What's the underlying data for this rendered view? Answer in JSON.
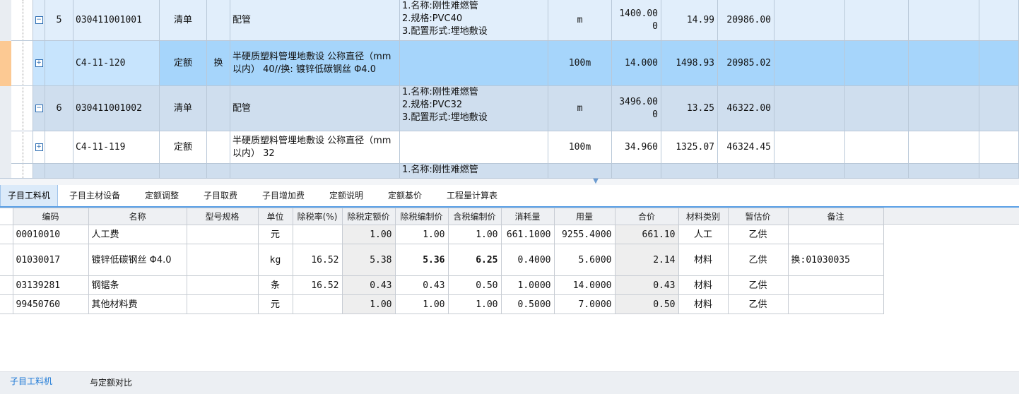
{
  "top_grid": {
    "rows": [
      {
        "toggle": "⊟",
        "seq": "5",
        "code": "030411001001",
        "type": "清单",
        "swap": "",
        "name": "配管",
        "feature": "1.名称:刚性难燃管\n2.规格:PVC40\n3.配置形式:埋地敷设",
        "unit": "m",
        "qty": "1400.00\n0",
        "price": "14.99",
        "total": "20986.00"
      },
      {
        "toggle": "⊞",
        "seq": "",
        "code": "C4-11-120",
        "type": "定额",
        "swap": "换",
        "name": "半硬质塑料管埋地敷设 公称直径（mm以内） 40//换: 镀锌低碳钢丝 Φ4.0",
        "feature": "",
        "unit": "100m",
        "qty": "14.000",
        "price": "1498.93",
        "total": "20985.02"
      },
      {
        "toggle": "⊟",
        "seq": "6",
        "code": "030411001002",
        "type": "清单",
        "swap": "",
        "name": "配管",
        "feature": "1.名称:刚性难燃管\n2.规格:PVC32\n3.配置形式:埋地敷设",
        "unit": "m",
        "qty": "3496.00\n0",
        "price": "13.25",
        "total": "46322.00"
      },
      {
        "toggle": "⊞",
        "seq": "",
        "code": "C4-11-119",
        "type": "定额",
        "swap": "",
        "name": "半硬质塑料管埋地敷设 公称直径（mm以内） 32",
        "feature": "",
        "unit": "100m",
        "qty": "34.960",
        "price": "1325.07",
        "total": "46324.45"
      },
      {
        "toggle": "",
        "seq": "",
        "code": "",
        "type": "",
        "swap": "",
        "name": "",
        "feature": "1.名称:刚性难燃管",
        "unit": "",
        "qty": "",
        "price": "",
        "total": ""
      }
    ]
  },
  "tabs": [
    "子目工料机",
    "子目主材设备",
    "定额调整",
    "子目取费",
    "子目增加费",
    "定额说明",
    "定额基价",
    "工程量计算表"
  ],
  "table": {
    "headers": [
      "编码",
      "名称",
      "型号规格",
      "单位",
      "除税率(%)",
      "除税定额价",
      "除税编制价",
      "含税编制价",
      "消耗量",
      "用量",
      "合价",
      "材料类别",
      "暂估价",
      "备注"
    ],
    "rows": [
      [
        "00010010",
        "人工费",
        "",
        "元",
        "",
        "1.00",
        "1.00",
        "1.00",
        "661.1000",
        "9255.4000",
        "661.10",
        "人工",
        "乙供",
        ""
      ],
      [
        "01030017",
        "镀锌低碳钢丝 Φ4.0",
        "",
        "kg",
        "16.52",
        "5.38",
        "5.36",
        "6.25",
        "0.4000",
        "5.6000",
        "2.14",
        "材料",
        "乙供",
        "换:01030035"
      ],
      [
        "03139281",
        "钢锯条",
        "",
        "条",
        "16.52",
        "0.43",
        "0.43",
        "0.50",
        "1.0000",
        "14.0000",
        "0.43",
        "材料",
        "乙供",
        ""
      ],
      [
        "99450760",
        "其他材料费",
        "",
        "元",
        "",
        "1.00",
        "1.00",
        "1.00",
        "0.5000",
        "7.0000",
        "0.50",
        "材料",
        "乙供",
        ""
      ]
    ]
  },
  "footer_tabs": [
    "子目工料机",
    "与定额对比"
  ],
  "colors": {
    "selected_row": "#a6d5fb",
    "list_row_a": "#e1eefb",
    "list_row_b": "#cfdeee",
    "accent": "#1f7ad6"
  }
}
